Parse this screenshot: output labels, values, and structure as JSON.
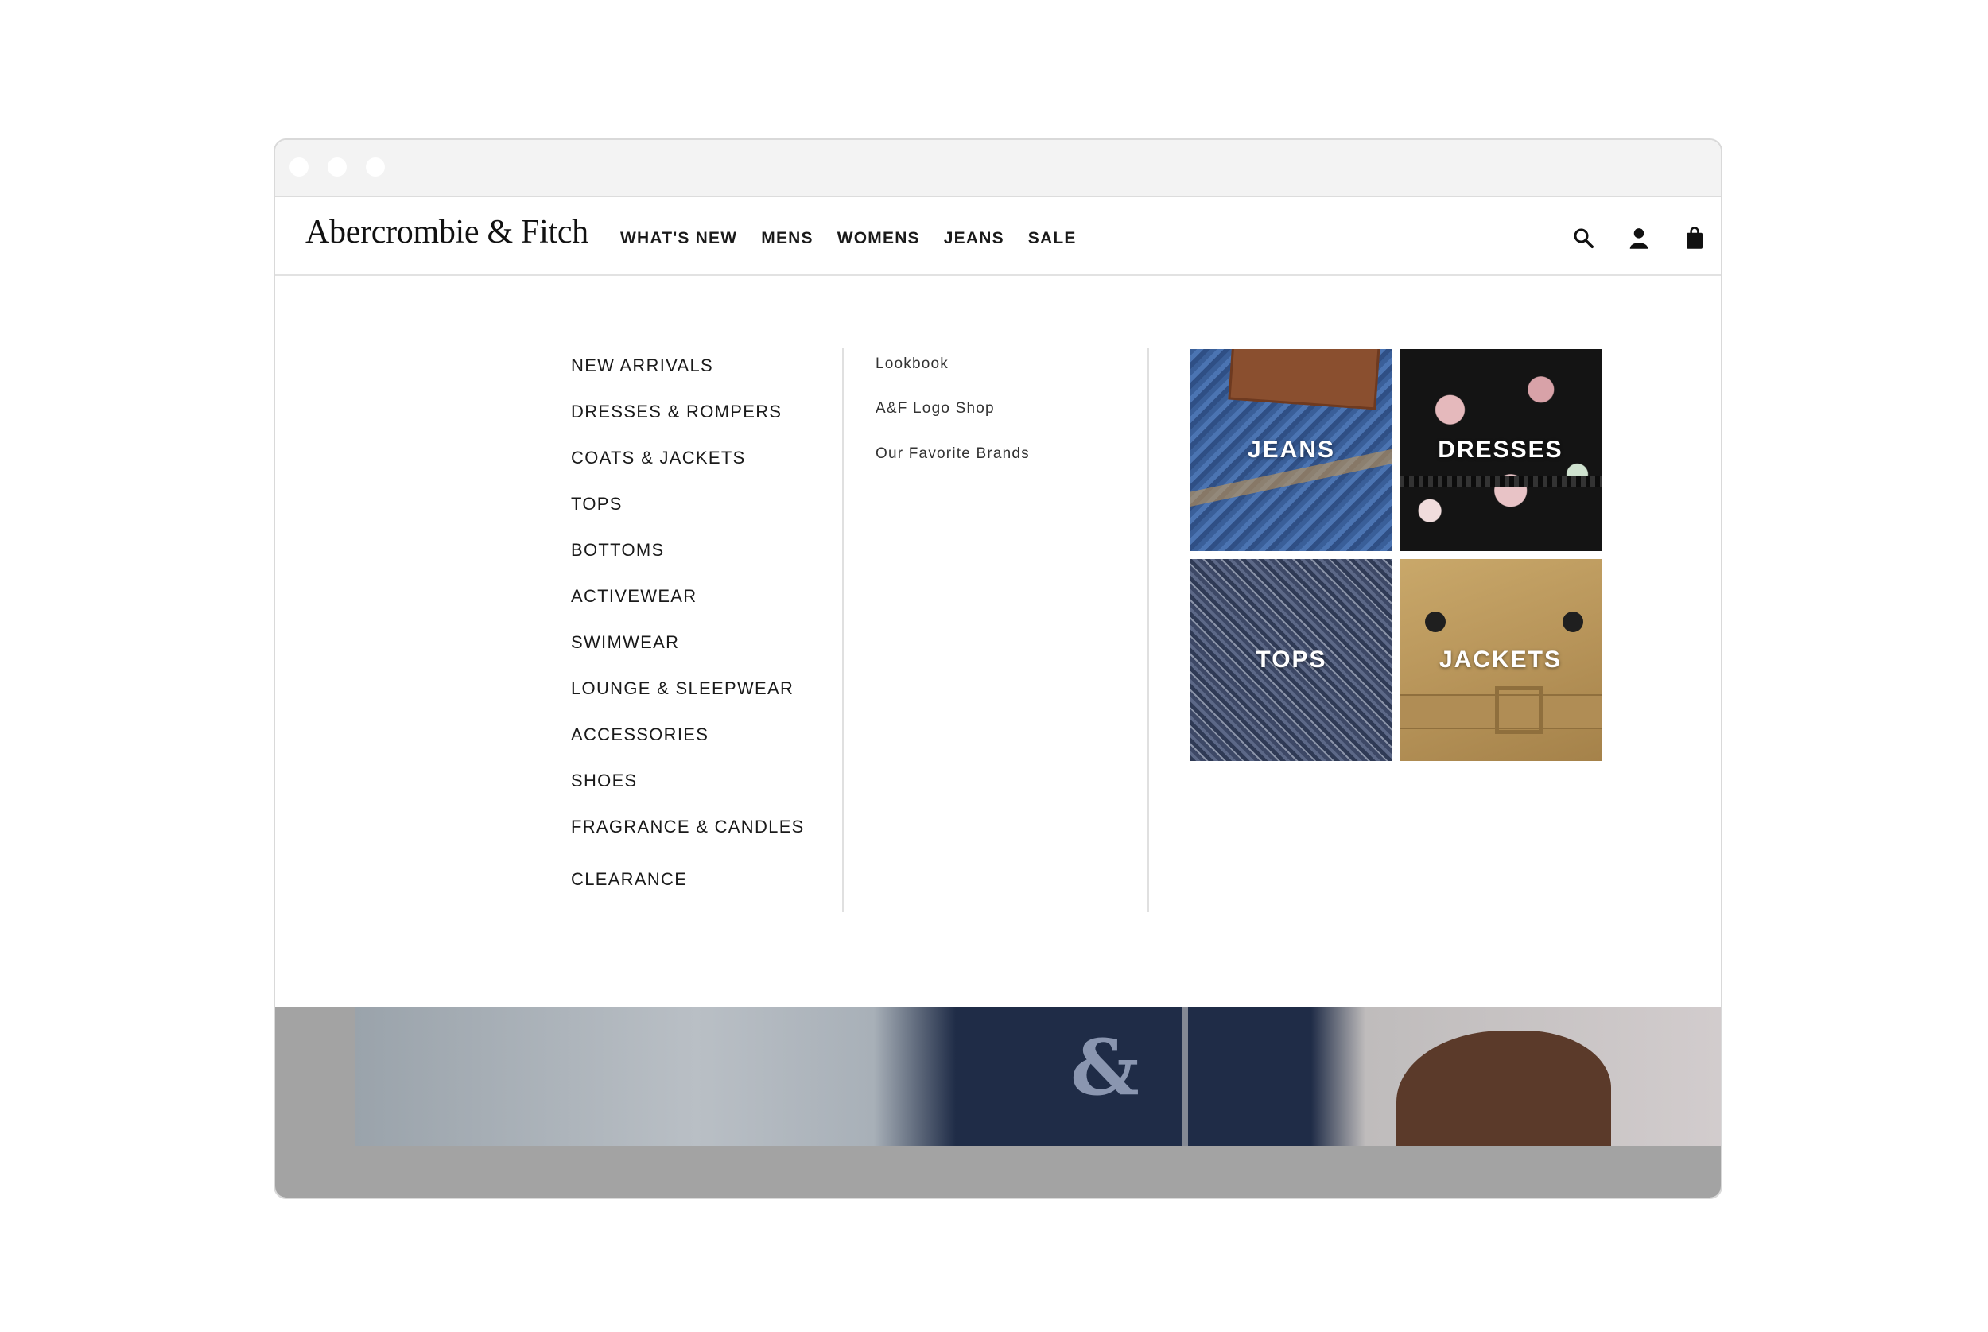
{
  "window": {
    "controls": [
      "close",
      "minimize",
      "maximize"
    ]
  },
  "header": {
    "logo": "Abercrombie & Fitch",
    "nav": [
      "WHAT'S NEW",
      "MENS",
      "WOMENS",
      "JEANS",
      "SALE"
    ],
    "icons": [
      "search-icon",
      "account-icon",
      "bag-icon"
    ]
  },
  "menu": {
    "categories": [
      "NEW ARRIVALS",
      "DRESSES & ROMPERS",
      "COATS & JACKETS",
      "TOPS",
      "BOTTOMS",
      "ACTIVEWEAR",
      "SWIMWEAR",
      "LOUNGE & SLEEPWEAR",
      "ACCESSORIES",
      "SHOES",
      "FRAGRANCE & CANDLES",
      "CLEARANCE"
    ],
    "links": [
      "Lookbook",
      "A&F Logo Shop",
      "Our Favorite Brands"
    ],
    "tiles": [
      "JEANS",
      "DRESSES",
      "TOPS",
      "JACKETS"
    ]
  }
}
